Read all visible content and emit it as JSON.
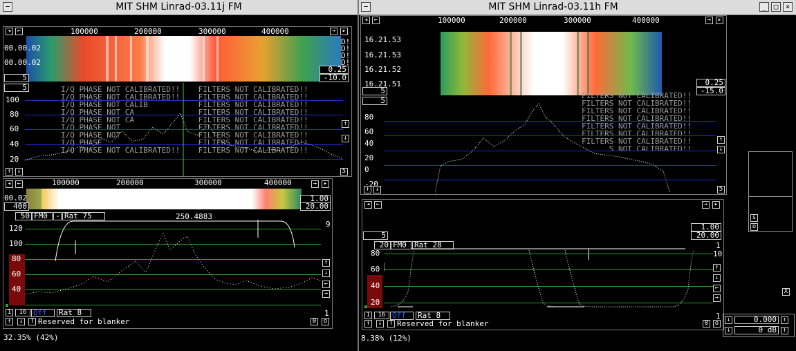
{
  "left_window": {
    "title": "MIT SHM Linrad-03.11j FM",
    "wide_freq_labels": [
      "100000",
      "200000",
      "300000",
      "400000"
    ],
    "waterfall_times": [
      "00.00.02",
      "00.00.02"
    ],
    "waterfall_right_marks": [
      "D!",
      "D!",
      "D!",
      "D!",
      "D!"
    ],
    "wf_box_left": "5",
    "wf_box_gain": "0.25",
    "wf_box_offset": "-10.0",
    "spectrum_box_left": "5",
    "spectrum_ylabels": [
      "100",
      "80",
      "60",
      "40",
      "20"
    ],
    "spectrum_avg_box": "5",
    "message_rows": [
      "I/Q PHASE NOT CALIBRATED!!    FILTERS NOT CALIBRATED!!",
      "I/Q PHASE NOT CALIBRATED!!    FILTERS NOT CALIBRATED!!",
      "I/Q PHASE NOT CALIB           FILTERS NOT CALIBRATED!!",
      "I/Q PHASE NOT CA              FILTERS NOT CALIBRATED!!",
      "I/Q PHASE NOT CA              FILTERS NOT CALIBRATED!!",
      "I/Q PHASE NOT                 FILTERS NOT CALIBRATED!!",
      "I/Q PHASE NOT                 FILTERS NOT CALIBRATED!!",
      "I/Q PHASE                     FILTERS NOT CALIBRATED!!",
      "I/Q PHASE NOT CALIBRATED!!    FILTERS NOT CALIBRATED!!"
    ],
    "hires_freq_labels": [
      "100000",
      "200000",
      "300000",
      "400000"
    ],
    "hires_time": "00.02",
    "hires_left_box": "400",
    "hires_box_gain": "1.00",
    "hires_box_offset": "20.00",
    "mode_avg": "50",
    "mode_name": "FM0",
    "mode_dash": "-",
    "mode_rat": "Rat 75",
    "mode_freq": "250.4883",
    "mode_right_num": "9",
    "baseband_ylabels": [
      "120",
      "100",
      "80",
      "60",
      "40"
    ],
    "baseband_bottom": {
      "one": "1",
      "sixteen": "16",
      "off": "Off",
      "rat": "Rat  8",
      "right": "1"
    },
    "reserved": "Reserved for blanker",
    "zero_btn": "0",
    "o_btn": "o",
    "t_btn": "T",
    "cpu_status": "32.35%  (42%)"
  },
  "right_window": {
    "title": "MIT SHM Linrad-03.11h FM",
    "wide_freq_labels": [
      "100000",
      "200000",
      "300000",
      "400000"
    ],
    "waterfall_times": [
      "16.21.53",
      "16.21.53",
      "16.21.52",
      "16.21.51"
    ],
    "wf_box_left": "5",
    "wf_box_gain": "0.25",
    "wf_box_offset": "-15.0",
    "spectrum_box_left": "5",
    "spectrum_ylabels": [
      "80",
      "60",
      "40",
      "20",
      "0",
      "-20"
    ],
    "spectrum_avg_box": "5",
    "message_rows": [
      "FILTERS NOT CALIBRATED!!",
      "FILTERS NOT CALIBRATED!!",
      "FILTERS NOT CALIBRATED!!",
      "FILTERS NOT CALIBRATED!!",
      "FILTERS NOT CALIBRATED!!",
      "FILTERS NOT CALIBRATED!!",
      "FILTERS NOT CALIBRATED!!",
      "      S NOT CALIBRATED!!",
      "FILTERS NOT CALIBRATED!!"
    ],
    "hires_left_box": "5",
    "hires_box_gain": "1.00",
    "hires_box_offset": "20.00",
    "mode_avg": "20",
    "mode_name": "FM0",
    "mode_rat": "Rat 28",
    "mode_right_num": "1",
    "mode_right_num2": "10",
    "baseband_ylabels": [
      "80",
      "60",
      "40",
      "20"
    ],
    "baseband_bottom": {
      "one": "1",
      "sixteen": "16",
      "off": "Off",
      "rat": "Rat  8",
      "right": "1"
    },
    "reserved": "Reserved for blanker",
    "zero_btn": "0",
    "o_btn": "o",
    "t_btn": "T",
    "cpu_status": "8.38%  (12%)",
    "side_s": "s",
    "side_o": "o",
    "side_x": "X",
    "volume_value": "0.000",
    "gain_value": "0 dB"
  },
  "colors": {
    "accent_red": "#7a0a0a",
    "grid_blue": "#1e2fd0",
    "grid_green": "#2ea02e",
    "off_blue": "#2f5bff"
  }
}
